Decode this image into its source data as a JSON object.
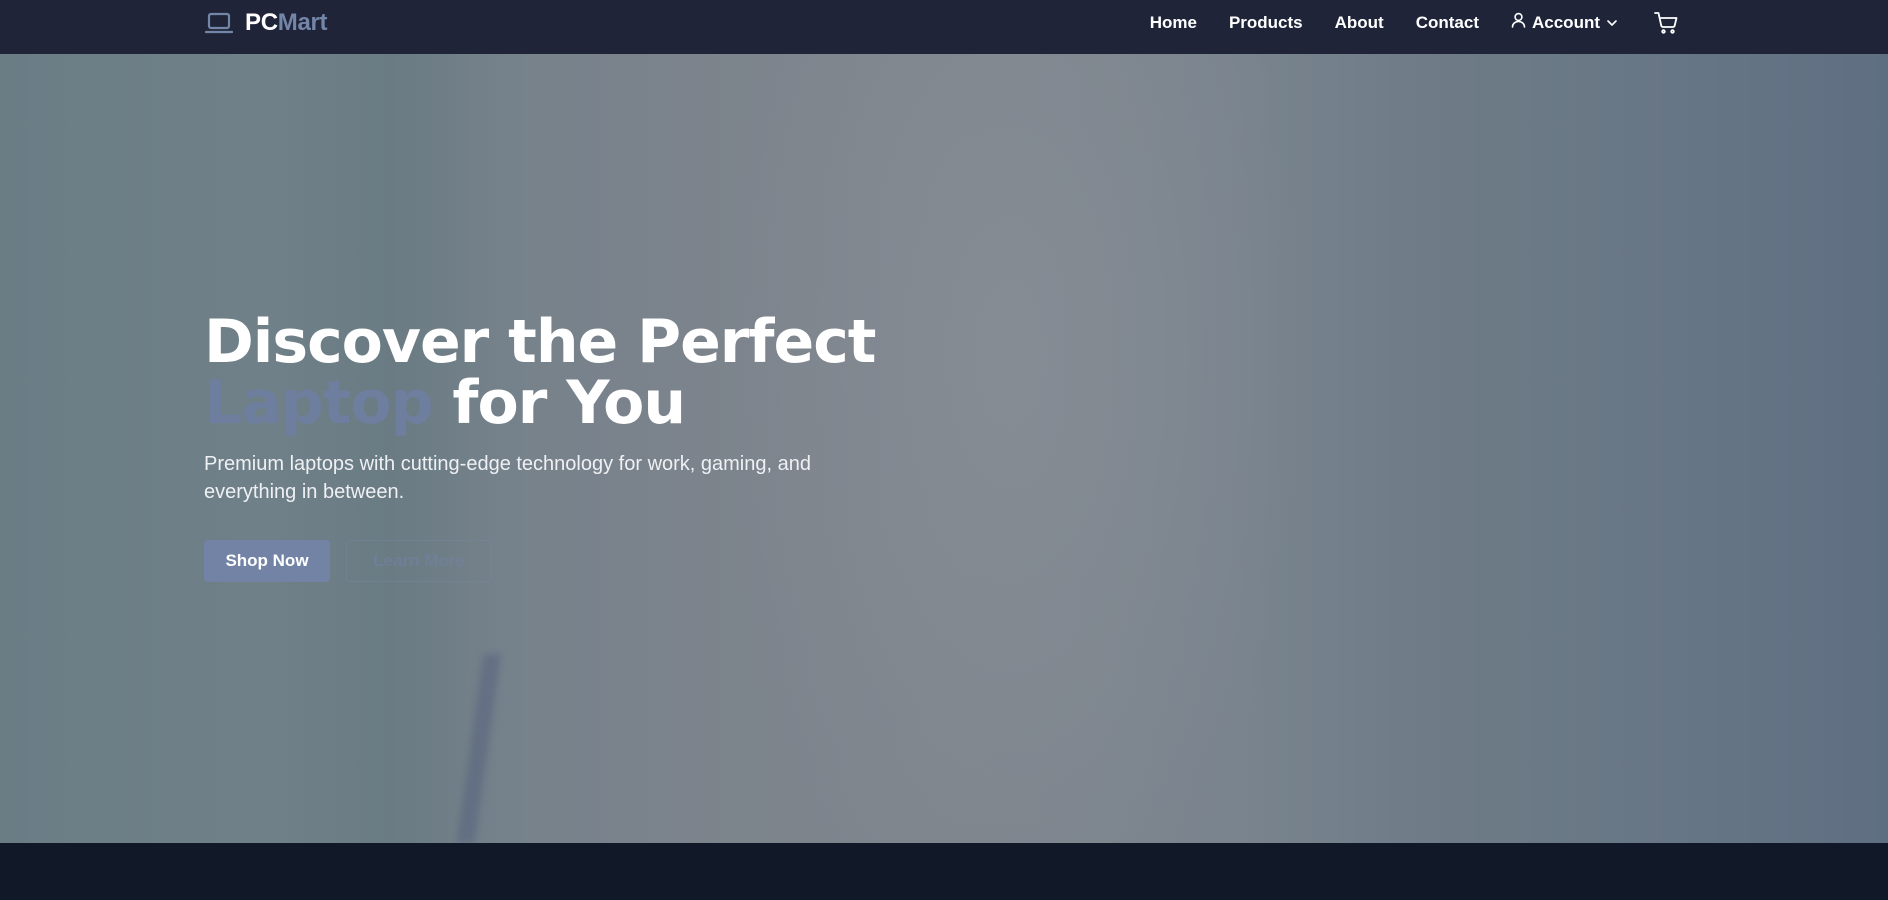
{
  "brand": {
    "part1": "PC",
    "part2": "Mart",
    "icon": "laptop-icon"
  },
  "nav": {
    "links": [
      "Home",
      "Products",
      "About",
      "Contact"
    ],
    "account_label": "Account",
    "account_icon": "user-icon",
    "cart_icon": "cart-icon"
  },
  "hero": {
    "title_line1": "Discover the Perfect",
    "title_accent": "Laptop",
    "title_rest": " for You",
    "subtitle": "Premium laptops with cutting-edge technology for work, gaming, and everything in between.",
    "primary_button": "Shop Now",
    "secondary_button": "Learn More"
  },
  "colors": {
    "navbar": "#1f2439",
    "accent": "#7283a6",
    "footer": "#111827"
  }
}
